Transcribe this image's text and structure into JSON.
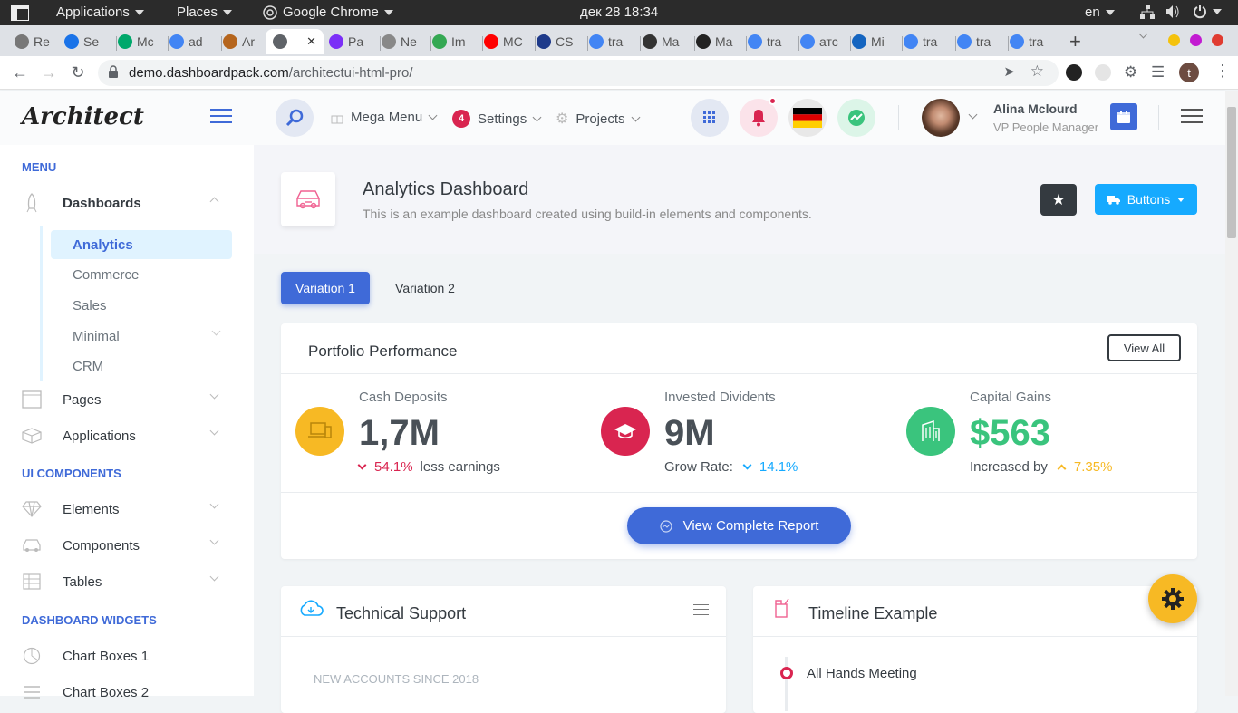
{
  "os": {
    "applications": "Applications",
    "places": "Places",
    "browser": "Google Chrome",
    "datetime": "дек 28  18:34",
    "lang": "en"
  },
  "tabs": [
    {
      "label": "Re",
      "color": "#777"
    },
    {
      "label": "Se",
      "color": "#1a73e8"
    },
    {
      "label": "Mc",
      "color": "#00a86b"
    },
    {
      "label": "ad",
      "color": "#4285f4"
    },
    {
      "label": "Ar",
      "color": "#b5651d"
    },
    {
      "label": "",
      "color": "#5f6368"
    },
    {
      "label": "Pa",
      "color": "#7b2ff7"
    },
    {
      "label": "Ne",
      "color": "#888"
    },
    {
      "label": "Im",
      "color": "#34a853"
    },
    {
      "label": "MC",
      "color": "#ff0000"
    },
    {
      "label": "CS",
      "color": "#1e3a8a"
    },
    {
      "label": "tra",
      "color": "#4285f4"
    },
    {
      "label": "Ma",
      "color": "#333"
    },
    {
      "label": "Ma",
      "color": "#222"
    },
    {
      "label": "tra",
      "color": "#4285f4"
    },
    {
      "label": "атс",
      "color": "#4285f4"
    },
    {
      "label": "Mi",
      "color": "#1565c0"
    },
    {
      "label": "tra",
      "color": "#4285f4"
    },
    {
      "label": "tra",
      "color": "#4285f4"
    },
    {
      "label": "tra",
      "color": "#4285f4"
    }
  ],
  "address": {
    "host": "demo.dashboardpack.com",
    "path": "/architectui-html-pro/"
  },
  "header": {
    "logo": "Architect",
    "mega_menu": "Mega Menu",
    "settings": "Settings",
    "settings_badge": "4",
    "projects": "Projects",
    "user_name": "Alina Mclourd",
    "user_role": "VP People Manager"
  },
  "sidebar": {
    "menu_heading": "MENU",
    "dashboards": "Dashboards",
    "sub": [
      "Analytics",
      "Commerce",
      "Sales",
      "Minimal",
      "CRM"
    ],
    "pages": "Pages",
    "applications": "Applications",
    "ui_heading": "UI COMPONENTS",
    "elements": "Elements",
    "components": "Components",
    "tables": "Tables",
    "widgets_heading": "DASHBOARD WIDGETS",
    "chart_boxes_1": "Chart Boxes 1",
    "chart_boxes_2": "Chart Boxes 2"
  },
  "page": {
    "title": "Analytics Dashboard",
    "subtitle": "This is an example dashboard created using build-in elements and components.",
    "buttons_label": "Buttons",
    "tab1": "Variation 1",
    "tab2": "Variation 2"
  },
  "portfolio": {
    "title": "Portfolio Performance",
    "view_all": "View All",
    "stats": [
      {
        "label": "Cash Deposits",
        "value": "1,7M",
        "change": "54.1%",
        "suffix": "less earnings",
        "prefix": "",
        "color": "#f7b924",
        "change_color": "#d92550"
      },
      {
        "label": "Invested Dividents",
        "value": "9M",
        "change": "14.1%",
        "prefix": "Grow Rate:",
        "suffix": "",
        "color": "#d92550",
        "change_color": "#16aaff"
      },
      {
        "label": "Capital Gains",
        "value": "$563",
        "change": "7.35%",
        "prefix": "Increased by",
        "suffix": "",
        "color": "#3ac47d",
        "change_color": "#f7b924"
      }
    ],
    "report_button": "View Complete Report"
  },
  "support": {
    "title": "Technical Support",
    "accounts_label": "NEW ACCOUNTS SINCE 2018"
  },
  "timeline": {
    "title": "Timeline Example",
    "first_item": "All Hands Meeting"
  }
}
